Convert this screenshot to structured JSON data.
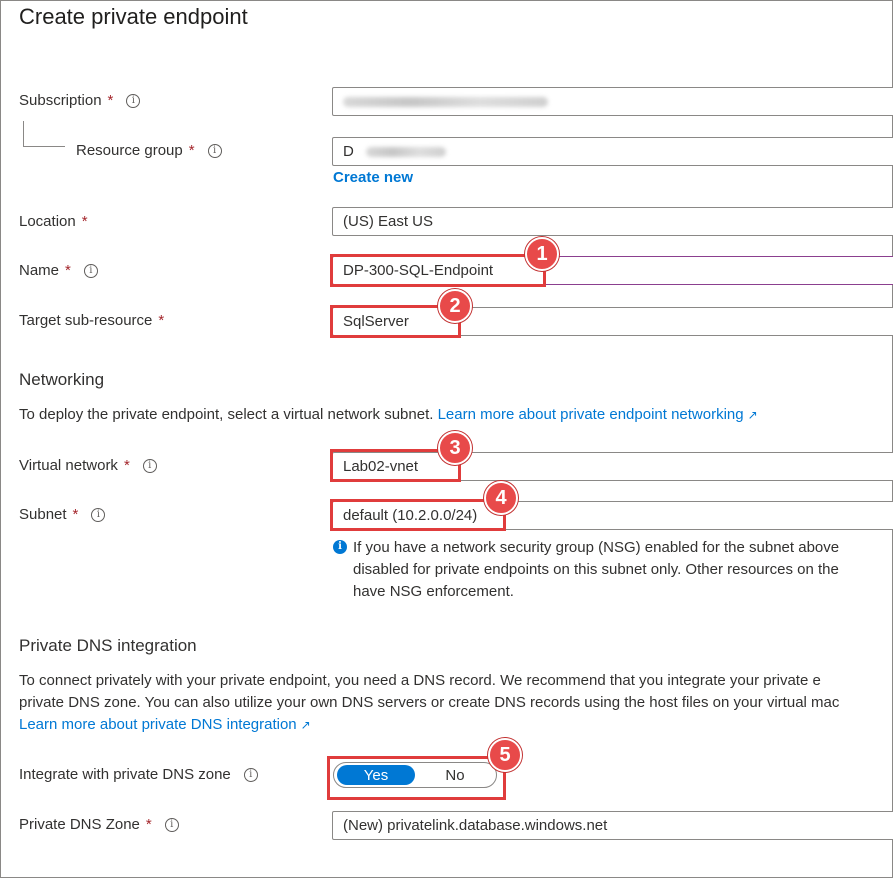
{
  "page_title": "Create private endpoint",
  "fields": {
    "subscription": {
      "label": "Subscription",
      "required": "*"
    },
    "resource_group": {
      "label": "Resource group",
      "required": "*",
      "value": "D"
    },
    "create_new": "Create new",
    "location": {
      "label": "Location",
      "required": "*",
      "value": "(US) East US"
    },
    "name": {
      "label": "Name",
      "required": "*",
      "value": "DP-300-SQL-Endpoint"
    },
    "target_sub_resource": {
      "label": "Target sub-resource",
      "required": "*",
      "value": "SqlServer"
    }
  },
  "networking": {
    "heading": "Networking",
    "description": "To deploy the private endpoint, select a virtual network subnet.",
    "learn_more": "Learn more about private endpoint networking",
    "virtual_network": {
      "label": "Virtual network",
      "required": "*",
      "value": "Lab02-vnet"
    },
    "subnet": {
      "label": "Subnet",
      "required": "*",
      "value": "default (10.2.0.0/24)"
    },
    "note_line1": "If you have a network security group (NSG) enabled for the subnet above",
    "note_line2": "disabled for private endpoints on this subnet only. Other resources on the",
    "note_line3": "have NSG enforcement."
  },
  "dns": {
    "heading": "Private DNS integration",
    "desc_line1": "To connect privately with your private endpoint, you need a DNS record. We recommend that you integrate your private e",
    "desc_line2": "private DNS zone. You can also utilize your own DNS servers or create DNS records using the host files on your virtual mac",
    "learn_more": "Learn more about private DNS integration",
    "integrate": {
      "label": "Integrate with private DNS zone",
      "yes": "Yes",
      "no": "No",
      "selected": "Yes"
    },
    "zone": {
      "label": "Private DNS Zone",
      "required": "*",
      "value": "(New) privatelink.database.windows.net"
    }
  },
  "markers": [
    "1",
    "2",
    "3",
    "4",
    "5"
  ],
  "icons": {
    "info": "info-icon",
    "external": "external-link-icon",
    "note": "info-filled-icon"
  },
  "colors": {
    "accent": "#0078d4",
    "required": "#a4262c",
    "highlight": "#e03c3c"
  }
}
